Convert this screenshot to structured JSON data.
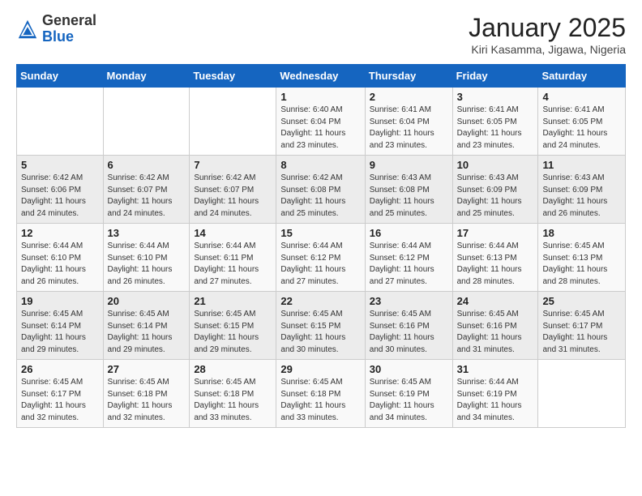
{
  "header": {
    "logo": {
      "general": "General",
      "blue": "Blue"
    },
    "title": "January 2025",
    "location": "Kiri Kasamma, Jigawa, Nigeria"
  },
  "calendar": {
    "days_of_week": [
      "Sunday",
      "Monday",
      "Tuesday",
      "Wednesday",
      "Thursday",
      "Friday",
      "Saturday"
    ],
    "weeks": [
      [
        {
          "day": "",
          "info": ""
        },
        {
          "day": "",
          "info": ""
        },
        {
          "day": "",
          "info": ""
        },
        {
          "day": "1",
          "info": "Sunrise: 6:40 AM\nSunset: 6:04 PM\nDaylight: 11 hours and 23 minutes."
        },
        {
          "day": "2",
          "info": "Sunrise: 6:41 AM\nSunset: 6:04 PM\nDaylight: 11 hours and 23 minutes."
        },
        {
          "day": "3",
          "info": "Sunrise: 6:41 AM\nSunset: 6:05 PM\nDaylight: 11 hours and 23 minutes."
        },
        {
          "day": "4",
          "info": "Sunrise: 6:41 AM\nSunset: 6:05 PM\nDaylight: 11 hours and 24 minutes."
        }
      ],
      [
        {
          "day": "5",
          "info": "Sunrise: 6:42 AM\nSunset: 6:06 PM\nDaylight: 11 hours and 24 minutes."
        },
        {
          "day": "6",
          "info": "Sunrise: 6:42 AM\nSunset: 6:07 PM\nDaylight: 11 hours and 24 minutes."
        },
        {
          "day": "7",
          "info": "Sunrise: 6:42 AM\nSunset: 6:07 PM\nDaylight: 11 hours and 24 minutes."
        },
        {
          "day": "8",
          "info": "Sunrise: 6:42 AM\nSunset: 6:08 PM\nDaylight: 11 hours and 25 minutes."
        },
        {
          "day": "9",
          "info": "Sunrise: 6:43 AM\nSunset: 6:08 PM\nDaylight: 11 hours and 25 minutes."
        },
        {
          "day": "10",
          "info": "Sunrise: 6:43 AM\nSunset: 6:09 PM\nDaylight: 11 hours and 25 minutes."
        },
        {
          "day": "11",
          "info": "Sunrise: 6:43 AM\nSunset: 6:09 PM\nDaylight: 11 hours and 26 minutes."
        }
      ],
      [
        {
          "day": "12",
          "info": "Sunrise: 6:44 AM\nSunset: 6:10 PM\nDaylight: 11 hours and 26 minutes."
        },
        {
          "day": "13",
          "info": "Sunrise: 6:44 AM\nSunset: 6:10 PM\nDaylight: 11 hours and 26 minutes."
        },
        {
          "day": "14",
          "info": "Sunrise: 6:44 AM\nSunset: 6:11 PM\nDaylight: 11 hours and 27 minutes."
        },
        {
          "day": "15",
          "info": "Sunrise: 6:44 AM\nSunset: 6:12 PM\nDaylight: 11 hours and 27 minutes."
        },
        {
          "day": "16",
          "info": "Sunrise: 6:44 AM\nSunset: 6:12 PM\nDaylight: 11 hours and 27 minutes."
        },
        {
          "day": "17",
          "info": "Sunrise: 6:44 AM\nSunset: 6:13 PM\nDaylight: 11 hours and 28 minutes."
        },
        {
          "day": "18",
          "info": "Sunrise: 6:45 AM\nSunset: 6:13 PM\nDaylight: 11 hours and 28 minutes."
        }
      ],
      [
        {
          "day": "19",
          "info": "Sunrise: 6:45 AM\nSunset: 6:14 PM\nDaylight: 11 hours and 29 minutes."
        },
        {
          "day": "20",
          "info": "Sunrise: 6:45 AM\nSunset: 6:14 PM\nDaylight: 11 hours and 29 minutes."
        },
        {
          "day": "21",
          "info": "Sunrise: 6:45 AM\nSunset: 6:15 PM\nDaylight: 11 hours and 29 minutes."
        },
        {
          "day": "22",
          "info": "Sunrise: 6:45 AM\nSunset: 6:15 PM\nDaylight: 11 hours and 30 minutes."
        },
        {
          "day": "23",
          "info": "Sunrise: 6:45 AM\nSunset: 6:16 PM\nDaylight: 11 hours and 30 minutes."
        },
        {
          "day": "24",
          "info": "Sunrise: 6:45 AM\nSunset: 6:16 PM\nDaylight: 11 hours and 31 minutes."
        },
        {
          "day": "25",
          "info": "Sunrise: 6:45 AM\nSunset: 6:17 PM\nDaylight: 11 hours and 31 minutes."
        }
      ],
      [
        {
          "day": "26",
          "info": "Sunrise: 6:45 AM\nSunset: 6:17 PM\nDaylight: 11 hours and 32 minutes."
        },
        {
          "day": "27",
          "info": "Sunrise: 6:45 AM\nSunset: 6:18 PM\nDaylight: 11 hours and 32 minutes."
        },
        {
          "day": "28",
          "info": "Sunrise: 6:45 AM\nSunset: 6:18 PM\nDaylight: 11 hours and 33 minutes."
        },
        {
          "day": "29",
          "info": "Sunrise: 6:45 AM\nSunset: 6:18 PM\nDaylight: 11 hours and 33 minutes."
        },
        {
          "day": "30",
          "info": "Sunrise: 6:45 AM\nSunset: 6:19 PM\nDaylight: 11 hours and 34 minutes."
        },
        {
          "day": "31",
          "info": "Sunrise: 6:44 AM\nSunset: 6:19 PM\nDaylight: 11 hours and 34 minutes."
        },
        {
          "day": "",
          "info": ""
        }
      ]
    ]
  }
}
